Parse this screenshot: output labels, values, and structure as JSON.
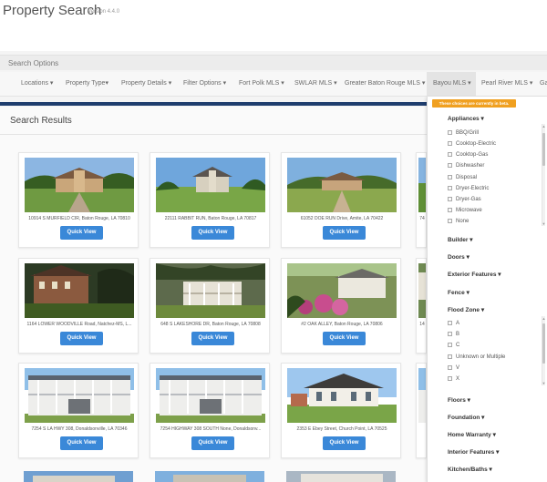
{
  "header": {
    "title": "Property Search",
    "version": "Version 4.4.0"
  },
  "search_options": {
    "label": "Search Options"
  },
  "menu": {
    "items": [
      {
        "label": "Locations ▾"
      },
      {
        "label": "Property Type▾"
      },
      {
        "label": "Property Details ▾"
      },
      {
        "label": "Filter Options ▾"
      },
      {
        "label": "Fort Polk MLS ▾"
      },
      {
        "label": "SWLAR MLS ▾"
      },
      {
        "label": "Greater Baton Rouge MLS ▾"
      },
      {
        "label": "Bayou MLS ▾"
      },
      {
        "label": "Pearl River MLS ▾"
      },
      {
        "label": "Ga"
      }
    ]
  },
  "results": {
    "title": "Search Results",
    "quick_view_label": "Quick View",
    "cards": [
      {
        "address": "10914 S MURFIELD CIR, Baton Rouge, LA 70810"
      },
      {
        "address": "22111 RABBIT RUN, Baton Rouge, LA 70817"
      },
      {
        "address": "61052 DOE RUN Drive, Amite, LA 70422"
      },
      {
        "address": "74"
      },
      {
        "address": "1164 LOWER WOODVILLE Road, Natchez-MS, L..."
      },
      {
        "address": "648 S LAKESHORE DR, Baton Rouge, LA 70808"
      },
      {
        "address": "#2 OAK ALLEY, Baton Rouge, LA 70806"
      },
      {
        "address": "14"
      },
      {
        "address": "7254 S LA HWY 308, Donaldsonville, LA 70346"
      },
      {
        "address": "7254 HIGHWAY 308 SOUTH None, Donaldsonv..."
      },
      {
        "address": "2353 E Ebey Street, Church Point, LA 70525"
      },
      {
        "address": ""
      }
    ]
  },
  "dropdown": {
    "beta_notice": "These choices are currently in beta.",
    "appliances": {
      "heading": "Appliances ▾",
      "options": [
        "BBQ/Grill",
        "Cooktop-Electric",
        "Cooktop-Gas",
        "Dishwasher",
        "Disposal",
        "Dryer-Electric",
        "Dryer-Gas",
        "Microwave",
        "None"
      ]
    },
    "sections_mid": [
      "Builder ▾",
      "Doors ▾",
      "Exterior Features ▾",
      "Fence ▾"
    ],
    "flood_zone": {
      "heading": "Flood Zone ▾",
      "options": [
        "A",
        "B",
        "C",
        "Unknown or Multiple",
        "V",
        "X"
      ]
    },
    "sections_bottom": [
      "Floors ▾",
      "Foundation ▾",
      "Home Warranty ▾",
      "Interior Features ▾",
      "Kitchen/Baths ▾"
    ]
  },
  "colors": {
    "accent": "#3a88d8",
    "nav_rule": "#1f3e6e",
    "beta": "#f0a020"
  }
}
